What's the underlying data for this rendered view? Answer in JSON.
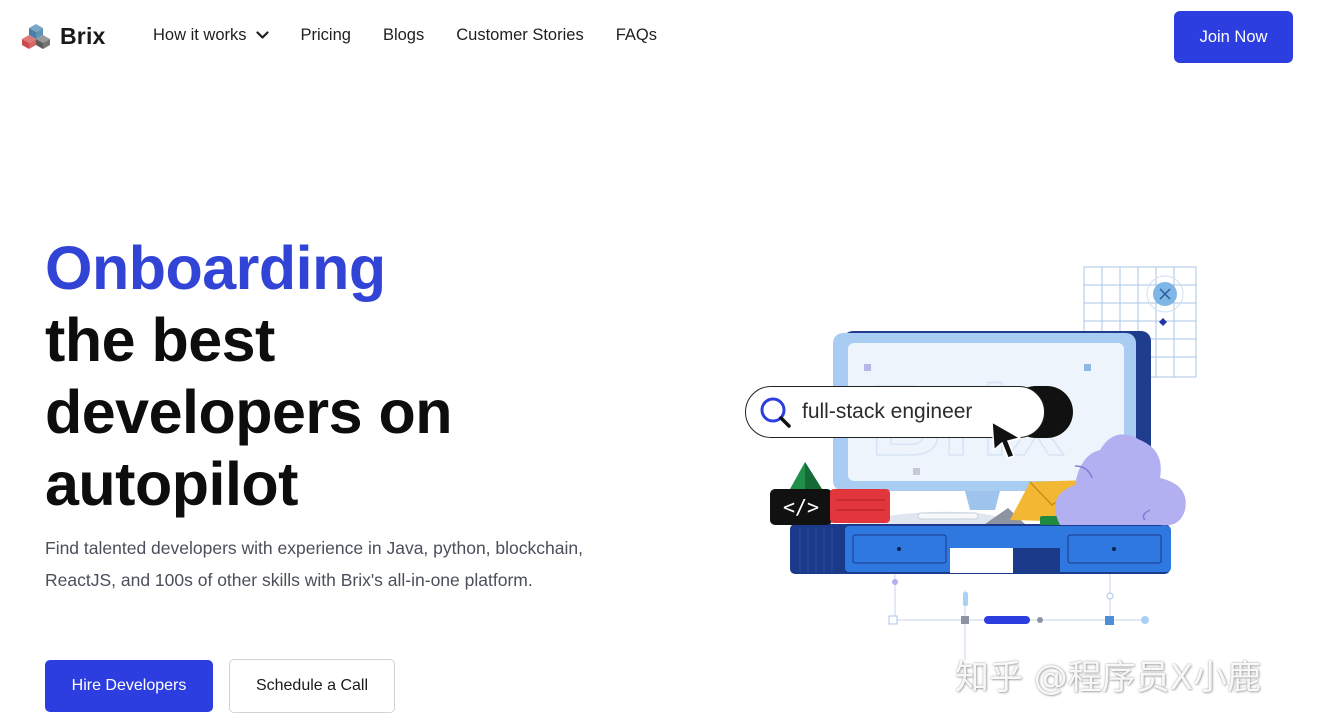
{
  "nav": {
    "logo_text": "Brix",
    "links": [
      "How it works",
      "Pricing",
      "Blogs",
      "Customer Stories",
      "FAQs"
    ],
    "cta": "Join Now"
  },
  "hero": {
    "title_accent": "Onboarding",
    "title_rest_1": "the best",
    "title_rest_2": "developers on",
    "title_rest_3": "autopilot",
    "subtitle": "Find talented developers with experience in Java, python, blockchain, ReactJS, and 100s of other skills with Brix's all-in-one platform.",
    "primary_button": "Hire Developers",
    "secondary_button": "Schedule a Call"
  },
  "illustration": {
    "search_query": "full-stack engineer",
    "code_tag": "</>"
  },
  "watermark": "知乎 @程序员X小鹿",
  "colors": {
    "accent": "#2d3ee0",
    "title_accent": "#3244d6",
    "text_dark": "#0d0d0d",
    "text_muted": "#4a4f5a"
  }
}
